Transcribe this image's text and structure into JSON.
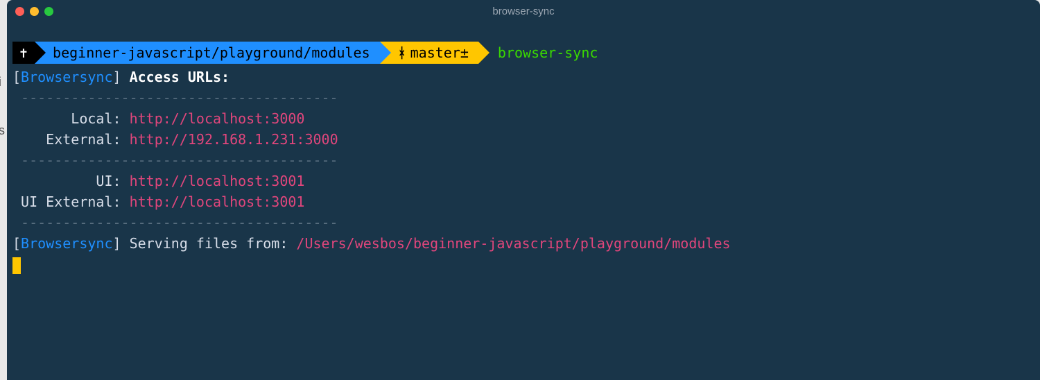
{
  "window": {
    "title": "browser-sync"
  },
  "prompt": {
    "cross": "✝",
    "path": "beginner-javascript/playground/modules",
    "branch_glyph": "ᚼ",
    "branch": "master±",
    "command": "browser-sync"
  },
  "output": {
    "tag_open": "[",
    "tag_name": "Browsersync",
    "tag_close": "]",
    "header": "Access URLs:",
    "dash_top": " --------------------------------------",
    "rows1": {
      "local_label": "       Local: ",
      "local_url": "http://localhost:3000",
      "external_label": "    External: ",
      "external_url": "http://192.168.1.231:3000"
    },
    "dash_mid": " --------------------------------------",
    "rows2": {
      "ui_label": "          UI: ",
      "ui_url": "http://localhost:3001",
      "uiext_label": " UI External: ",
      "uiext_url": "http://localhost:3001"
    },
    "dash_bot": " --------------------------------------",
    "serving_text": " Serving files from: ",
    "serving_path": "/Users/wesbos/beginner-javascript/playground/modules"
  },
  "side": {
    "i": "i",
    "s": "s"
  }
}
